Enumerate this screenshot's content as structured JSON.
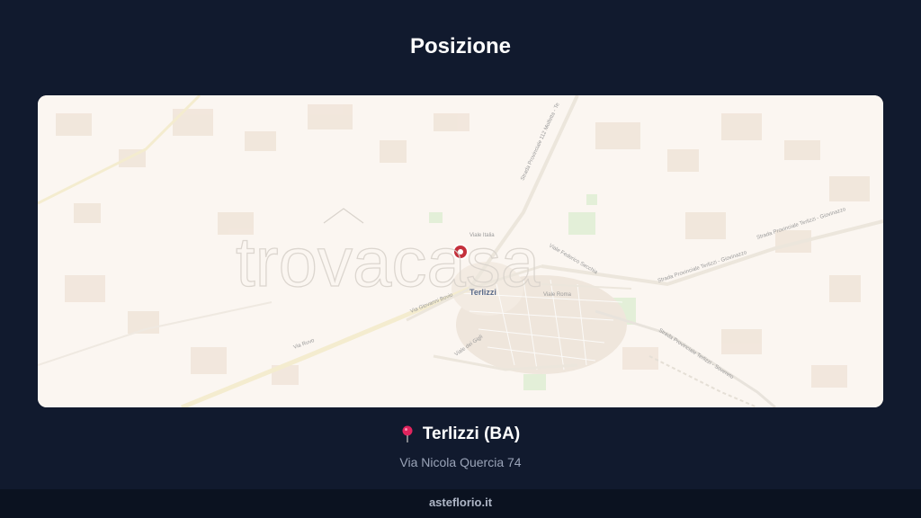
{
  "header": {
    "title": "Posizione"
  },
  "map": {
    "watermark": "trovacasa",
    "city_label": "Terlizzi",
    "street_labels": {
      "viale_italia": "Viale Italia",
      "via_ruvo": "Via Ruvo",
      "via_giovanni_bovio": "Via Giovanni Bovio",
      "viale_roma": "Viale Roma",
      "via_dei_gigli": "Viale dei Gigli",
      "viale_vecchio": "Viale Federico Secchia",
      "sp112": "Strada Provinciale 112 Molfetta - Te",
      "sp_giovinazzo": "Strada Provinciale Terlizzi - Giovinazzo",
      "sp_giovinazzo_2": "Strada Provinciale Terlizzi - Giovinazzo",
      "sp_sovereto": "Strada Provinciale Terlizzi - Sovereto"
    },
    "marker_icon": "location-marker-icon",
    "colors": {
      "marker": "#c4303c",
      "background": "#fbf6f1"
    }
  },
  "location": {
    "pin_icon": "round-pushpin-icon",
    "city": "Terlizzi (BA)",
    "address": "Via Nicola Quercia 74"
  },
  "footer": {
    "site": "asteflorio.it"
  }
}
